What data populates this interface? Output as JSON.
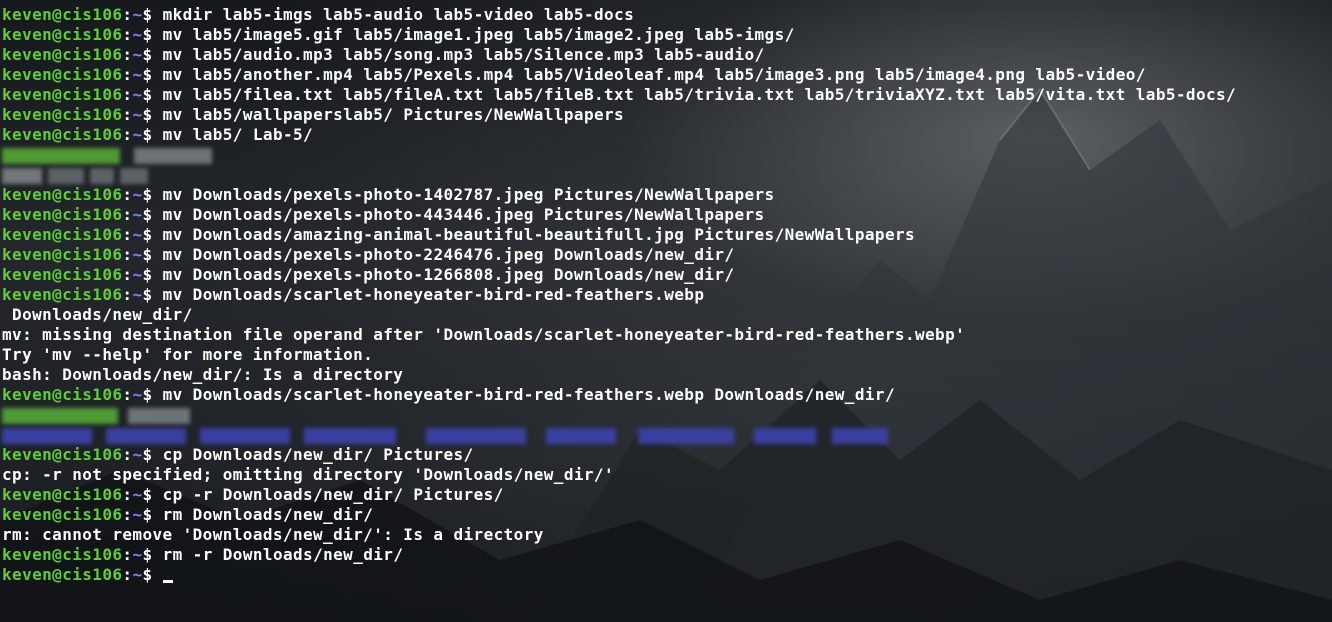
{
  "prompt": {
    "user_host": "keven@cis106",
    "sep": ":",
    "path": "~",
    "symbol": "$ "
  },
  "lines": [
    {
      "type": "cmd",
      "text": "mkdir lab5-imgs lab5-audio lab5-video lab5-docs"
    },
    {
      "type": "cmd",
      "text": "mv lab5/image5.gif lab5/image1.jpeg lab5/image2.jpeg lab5-imgs/"
    },
    {
      "type": "cmd",
      "text": "mv lab5/audio.mp3 lab5/song.mp3 lab5/Silence.mp3 lab5-audio/"
    },
    {
      "type": "cmd",
      "text": "mv lab5/another.mp4 lab5/Pexels.mp4 lab5/Videoleaf.mp4 lab5/image3.png lab5/image4.png lab5-video/"
    },
    {
      "type": "cmd",
      "text": "mv lab5/filea.txt lab5/fileA.txt lab5/fileB.txt lab5/trivia.txt lab5/triviaXYZ.txt lab5/vita.txt lab5-docs/"
    },
    {
      "type": "cmd",
      "text": "mv lab5/wallpaperslab5/ Pictures/NewWallpapers"
    },
    {
      "type": "cmd",
      "text": "mv lab5/ Lab-5/"
    },
    {
      "type": "redacted-green"
    },
    {
      "type": "redacted-gray"
    },
    {
      "type": "cmd",
      "text": "mv Downloads/pexels-photo-1402787.jpeg Pictures/NewWallpapers"
    },
    {
      "type": "cmd",
      "text": "mv Downloads/pexels-photo-443446.jpeg Pictures/NewWallpapers"
    },
    {
      "type": "cmd",
      "text": "mv Downloads/amazing-animal-beautiful-beautifull.jpg Pictures/NewWallpapers"
    },
    {
      "type": "cmd",
      "text": "mv Downloads/pexels-photo-2246476.jpeg Downloads/new_dir/"
    },
    {
      "type": "cmd",
      "text": "mv Downloads/pexels-photo-1266808.jpeg Downloads/new_dir/"
    },
    {
      "type": "cmd",
      "text": "mv Downloads/scarlet-honeyeater-bird-red-feathers.webp"
    },
    {
      "type": "out",
      "text": " Downloads/new_dir/"
    },
    {
      "type": "out",
      "text": "mv: missing destination file operand after 'Downloads/scarlet-honeyeater-bird-red-feathers.webp'"
    },
    {
      "type": "out",
      "text": "Try 'mv --help' for more information."
    },
    {
      "type": "out",
      "text": "bash: Downloads/new_dir/: Is a directory"
    },
    {
      "type": "cmd",
      "text": "mv Downloads/scarlet-honeyeater-bird-red-feathers.webp Downloads/new_dir/"
    },
    {
      "type": "redacted-green-short"
    },
    {
      "type": "redacted-blue"
    },
    {
      "type": "cmd",
      "text": "cp Downloads/new_dir/ Pictures/"
    },
    {
      "type": "out",
      "text": "cp: -r not specified; omitting directory 'Downloads/new_dir/'"
    },
    {
      "type": "cmd",
      "text": "cp -r Downloads/new_dir/ Pictures/"
    },
    {
      "type": "cmd",
      "text": "rm Downloads/new_dir/"
    },
    {
      "type": "out",
      "text": "rm: cannot remove 'Downloads/new_dir/': Is a directory"
    },
    {
      "type": "cmd",
      "text": "rm -r Downloads/new_dir/"
    },
    {
      "type": "prompt-cursor",
      "text": ""
    }
  ]
}
